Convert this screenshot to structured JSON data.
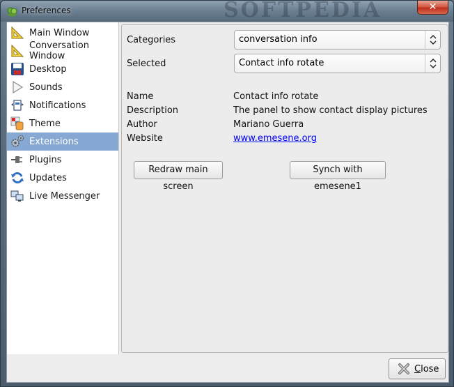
{
  "window": {
    "title": "Preferences",
    "watermark": "SOFTPEDIA",
    "close_glyph": "✕"
  },
  "sidebar": {
    "items": [
      {
        "label": "Main Window",
        "icon": "ruler-triangle-icon"
      },
      {
        "label": "Conversation Window",
        "icon": "ruler-triangle-icon"
      },
      {
        "label": "Desktop",
        "icon": "floppy-disk-icon"
      },
      {
        "label": "Sounds",
        "icon": "play-icon"
      },
      {
        "label": "Notifications",
        "icon": "notification-icon"
      },
      {
        "label": "Theme",
        "icon": "theme-icon"
      },
      {
        "label": "Extensions",
        "icon": "gears-icon",
        "selected": true
      },
      {
        "label": "Plugins",
        "icon": "plug-icon"
      },
      {
        "label": "Updates",
        "icon": "refresh-icon"
      },
      {
        "label": "Live Messenger",
        "icon": "computers-icon"
      }
    ]
  },
  "main": {
    "categories_label": "Categories",
    "categories_value": "conversation info",
    "selected_label": "Selected",
    "selected_value": "Contact info rotate",
    "info": {
      "name_label": "Name",
      "name_value": "Contact info rotate",
      "description_label": "Description",
      "description_value": "The panel to show contact display pictures",
      "author_label": "Author",
      "author_value": "Mariano Guerra",
      "website_label": "Website",
      "website_value": "www.emesene.org"
    },
    "redraw_button": "Redraw main screen",
    "synch_button": "Synch with emesene1"
  },
  "footer": {
    "close_button": "Close",
    "close_mnemonic": "C",
    "close_rest": "lose"
  },
  "colors": {
    "selection": "#86a8d2",
    "link": "#0000ee",
    "close_red": "#c0301c"
  }
}
